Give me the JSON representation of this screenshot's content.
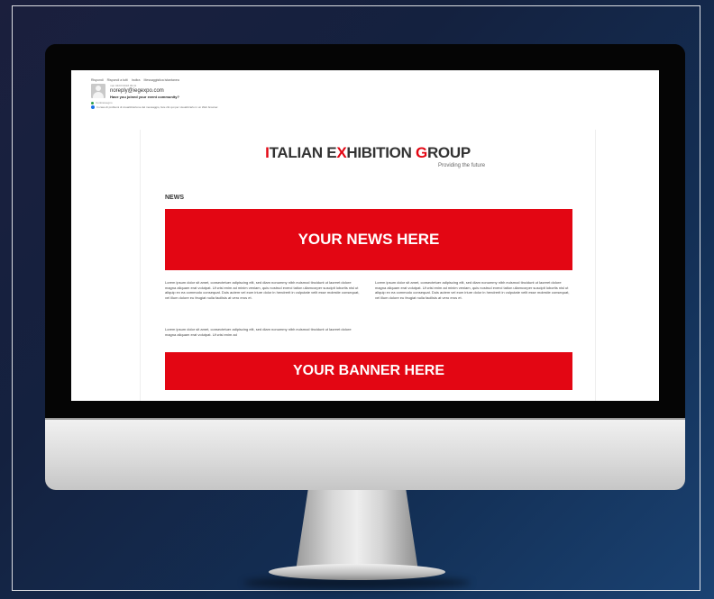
{
  "email": {
    "toolbar": [
      "Rispondi",
      "Rispondi a tutti",
      "Inoltra",
      "Messaggistica istantanea"
    ],
    "date": "mar 04/07/2018 09:31",
    "sender_email": "noreply@iegexpo.com",
    "subject": "Have you joined your event community?",
    "flag_text": "Contrassegno",
    "info_text": "In caso di problemi di visualizzazione del messaggio, fare clic qui per visualizzarlo in un Web browser."
  },
  "newsletter": {
    "logo": {
      "part1": "I",
      "part2": "TALIAN E",
      "part3": "X",
      "part4": "HIBITION ",
      "part5": "G",
      "part6": "ROUP"
    },
    "tagline": "Providing the future",
    "news_label": "NEWS",
    "news_banner": "YOUR NEWS HERE",
    "col_left_p1": "Lorem ipsum dolor sit amet, consectetuer adipiscing elit, sed diam nonummy nibh euismod tincidunt ut laoreet dolore magna aliquam erat volutpat. Ut wisi enim ad minim veniam, quis nostrud exerci tation ullamcorper suscipit lobortis nisl ut aliquip ex ea commodo consequat. Duis autem vel eum iriure dolor in hendrerit in vulputate velit esse molestie consequat, vel illum dolore eu feugiat nulla facilisis at vero eros et.",
    "col_left_p2": "Lorem ipsum dolor sit amet, consectetuer adipiscing elit, sed diam nonummy nibh euismod tincidunt ut laoreet dolore magna aliquam erat volutpat. Ut wisi enim ad",
    "col_right": "Lorem ipsum dolor sit amet, consectetuer adipiscing elit, sed diam nonummy nibh euismod tincidunt ut laoreet dolore magna aliquam erat volutpat. Ut wisi enim ad minim veniam, quis nostrud exerci tation ullamcorper suscipit lobortis nisl ut aliquip ex ea commodo consequat. Duis autem vel eum iriure dolor in hendrerit in vulputate velit esse molestie consequat, vel illum dolore eu feugiat nulla facilisis at vero eros et.",
    "banner": "YOUR BANNER HERE"
  },
  "colors": {
    "brand_red": "#e30613",
    "backdrop_dark": "#14213f"
  }
}
